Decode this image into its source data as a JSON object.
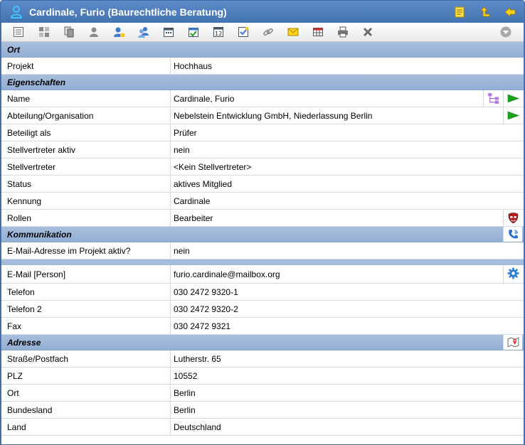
{
  "window": {
    "title": "Cardinale, Furio (Baurechtliche Beratung)"
  },
  "title_actions": [
    "notes-icon",
    "up-level-icon",
    "back-arrow-icon"
  ],
  "toolbar": {
    "buttons": [
      "list-icon",
      "grid-icon",
      "copy-icon",
      "person-icon",
      "person-edit-icon",
      "persons-icon",
      "calendar-icon",
      "calendar-check-icon",
      "calendar-date-icon",
      "checklist-icon",
      "link-icon",
      "mail-icon",
      "table-icon",
      "print-icon",
      "close-icon"
    ],
    "menu_icon": "circle-down-icon"
  },
  "sections": {
    "ort": {
      "title": "Ort",
      "projekt": {
        "label": "Projekt",
        "value": "Hochhaus"
      }
    },
    "eigenschaften": {
      "title": "Eigenschaften",
      "name": {
        "label": "Name",
        "value": "Cardinale, Furio"
      },
      "abteilung": {
        "label": "Abteilung/Organisation",
        "value": "Nebelstein Entwicklung GmbH, Niederlassung Berlin"
      },
      "beteiligt": {
        "label": "Beteiligt als",
        "value": "Prüfer"
      },
      "stv_aktiv": {
        "label": "Stellvertreter aktiv",
        "value": "nein"
      },
      "stv": {
        "label": "Stellvertreter",
        "value": "<Kein Stellvertreter>"
      },
      "status": {
        "label": "Status",
        "value": "aktives Mitglied"
      },
      "kennung": {
        "label": "Kennung",
        "value": "Cardinale"
      },
      "rollen": {
        "label": "Rollen",
        "value": "Bearbeiter"
      }
    },
    "kommunikation": {
      "title": "Kommunikation",
      "email_aktiv": {
        "label": "E-Mail-Adresse im Projekt aktiv?",
        "value": "nein"
      },
      "email": {
        "label": "E-Mail [Person]",
        "value": "furio.cardinale@mailbox.org"
      },
      "telefon": {
        "label": "Telefon",
        "value": "030 2472 9320-1"
      },
      "telefon2": {
        "label": "Telefon 2",
        "value": "030 2472 9320-2"
      },
      "fax": {
        "label": "Fax",
        "value": "030 2472 9321"
      }
    },
    "adresse": {
      "title": "Adresse",
      "strasse": {
        "label": "Straße/Postfach",
        "value": "Lutherstr. 65"
      },
      "plz": {
        "label": "PLZ",
        "value": "10552"
      },
      "ort": {
        "label": "Ort",
        "value": "Berlin"
      },
      "bundesland": {
        "label": "Bundesland",
        "value": "Berlin"
      },
      "land": {
        "label": "Land",
        "value": "Deutschland"
      }
    }
  },
  "colors": {
    "titlebar": "#4a78b6",
    "section_header": "#9db6d9",
    "row_border": "#d3dbe7",
    "accent_green": "#1aa31a"
  }
}
